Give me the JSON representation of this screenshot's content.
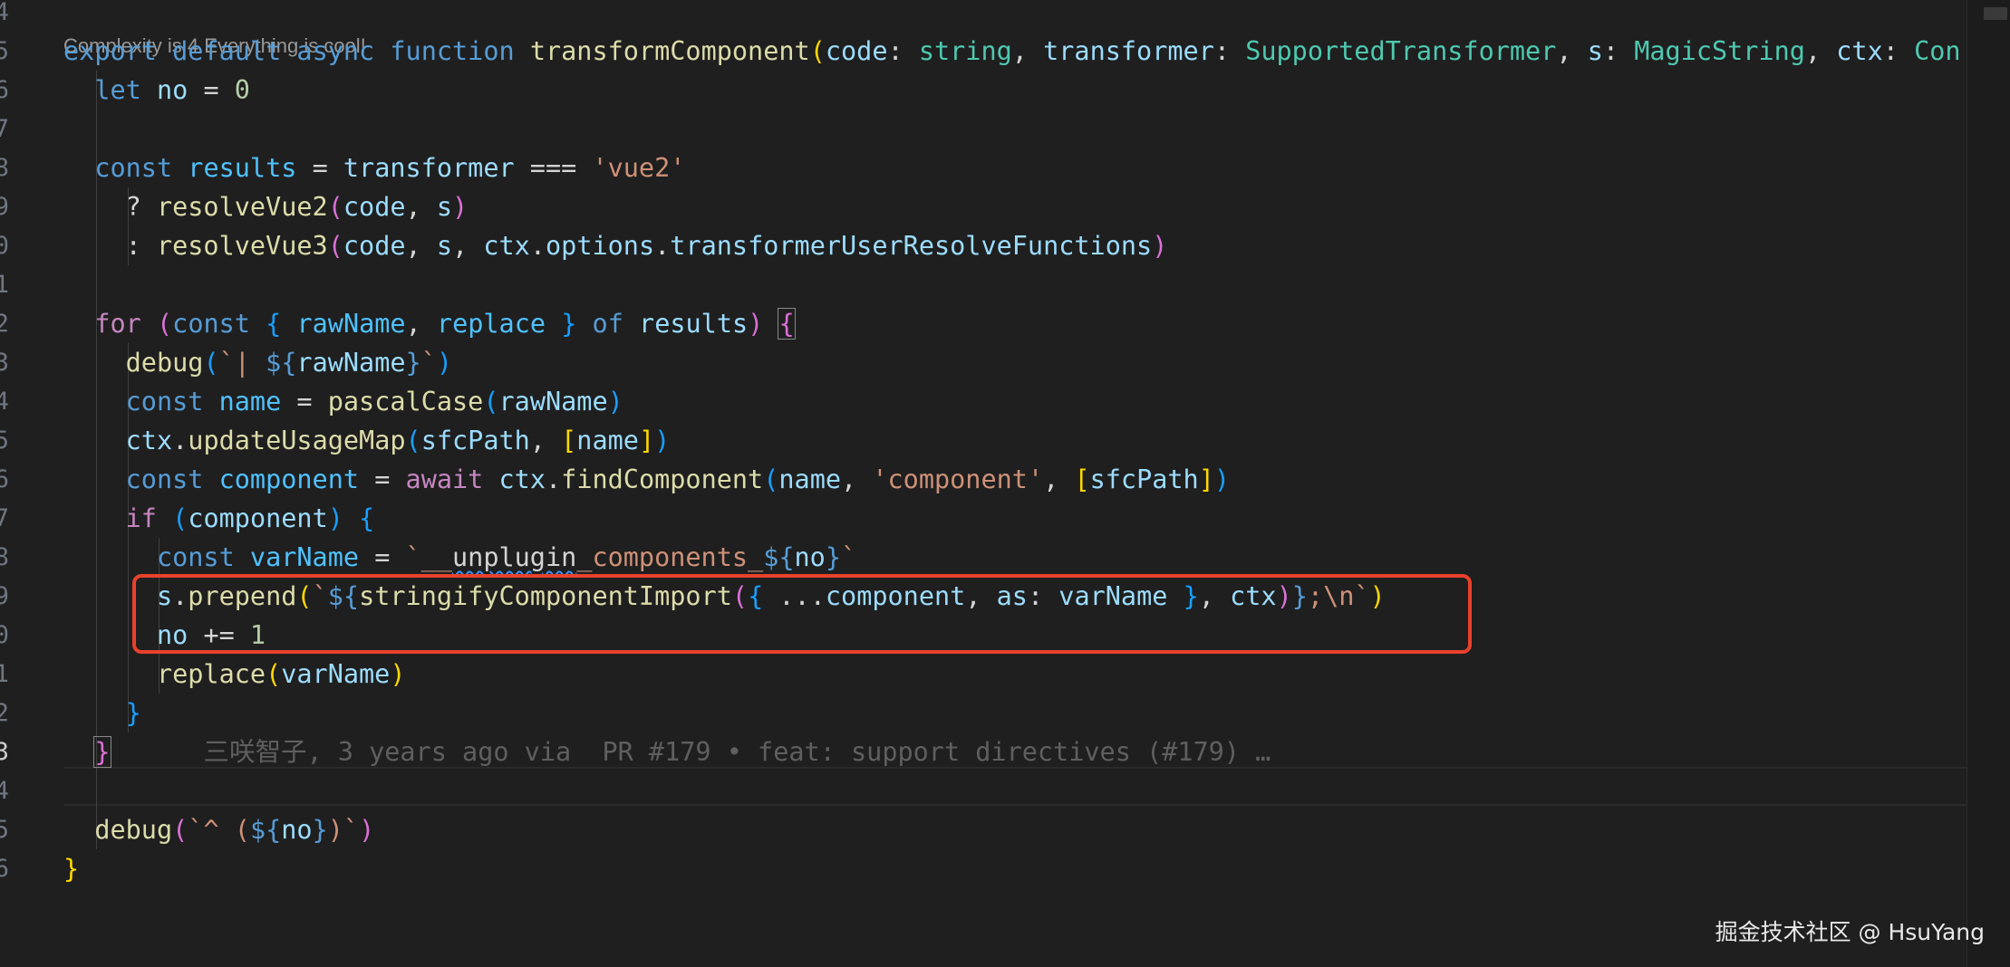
{
  "editor": {
    "codelens": "Complexity is 4 Everything is cool!",
    "blame": "三咲智子, 3 years ago via  PR #179 • feat: support directives (#179) …",
    "gutter": [
      "4",
      "5",
      "6",
      "7",
      "8",
      "9",
      "0",
      "1",
      "2",
      "3",
      "4",
      "5",
      "6",
      "7",
      "8",
      "9",
      "0",
      "1",
      "2",
      "3",
      "4",
      "5",
      "6"
    ],
    "lines": [
      [
        [
          "",
          ""
        ]
      ],
      [
        [
          "kw",
          "export"
        ],
        [
          "op",
          " "
        ],
        [
          "kw",
          "default"
        ],
        [
          "op",
          " "
        ],
        [
          "kw",
          "async"
        ],
        [
          "op",
          " "
        ],
        [
          "kw",
          "function"
        ],
        [
          "op",
          " "
        ],
        [
          "fn",
          "transformComponent"
        ],
        [
          "b1",
          "("
        ],
        [
          "var",
          "code"
        ],
        [
          "op",
          ": "
        ],
        [
          "ty",
          "string"
        ],
        [
          "op",
          ", "
        ],
        [
          "var",
          "transformer"
        ],
        [
          "op",
          ": "
        ],
        [
          "ty",
          "SupportedTransformer"
        ],
        [
          "op",
          ", "
        ],
        [
          "var",
          "s"
        ],
        [
          "op",
          ": "
        ],
        [
          "ty",
          "MagicString"
        ],
        [
          "op",
          ", "
        ],
        [
          "var",
          "ctx"
        ],
        [
          "op",
          ": "
        ],
        [
          "ty",
          "Con"
        ]
      ],
      [
        [
          "op",
          "  "
        ],
        [
          "kw",
          "let"
        ],
        [
          "op",
          " "
        ],
        [
          "var",
          "no"
        ],
        [
          "op",
          " = "
        ],
        [
          "num",
          "0"
        ]
      ],
      [
        [
          "op",
          ""
        ]
      ],
      [
        [
          "op",
          "  "
        ],
        [
          "kw",
          "const"
        ],
        [
          "op",
          " "
        ],
        [
          "cst",
          "results"
        ],
        [
          "op",
          " = "
        ],
        [
          "var",
          "transformer"
        ],
        [
          "op",
          " === "
        ],
        [
          "str",
          "'vue2'"
        ]
      ],
      [
        [
          "op",
          "    ? "
        ],
        [
          "fn",
          "resolveVue2"
        ],
        [
          "b2",
          "("
        ],
        [
          "var",
          "code"
        ],
        [
          "op",
          ", "
        ],
        [
          "var",
          "s"
        ],
        [
          "b2",
          ")"
        ]
      ],
      [
        [
          "op",
          "    : "
        ],
        [
          "fn",
          "resolveVue3"
        ],
        [
          "b2",
          "("
        ],
        [
          "var",
          "code"
        ],
        [
          "op",
          ", "
        ],
        [
          "var",
          "s"
        ],
        [
          "op",
          ", "
        ],
        [
          "var",
          "ctx"
        ],
        [
          "op",
          "."
        ],
        [
          "var",
          "options"
        ],
        [
          "op",
          "."
        ],
        [
          "var",
          "transformerUserResolveFunctions"
        ],
        [
          "b2",
          ")"
        ]
      ],
      [
        [
          "op",
          ""
        ]
      ],
      [
        [
          "op",
          "  "
        ],
        [
          "ctl",
          "for"
        ],
        [
          "op",
          " "
        ],
        [
          "b2",
          "("
        ],
        [
          "kw",
          "const"
        ],
        [
          "op",
          " "
        ],
        [
          "b3",
          "{"
        ],
        [
          "op",
          " "
        ],
        [
          "cst",
          "rawName"
        ],
        [
          "op",
          ", "
        ],
        [
          "cst",
          "replace"
        ],
        [
          "op",
          " "
        ],
        [
          "b3",
          "}"
        ],
        [
          "op",
          " "
        ],
        [
          "kw",
          "of"
        ],
        [
          "op",
          " "
        ],
        [
          "var",
          "results"
        ],
        [
          "b2",
          ")"
        ],
        [
          "op",
          " "
        ],
        [
          "b2",
          "{"
        ]
      ],
      [
        [
          "op",
          "    "
        ],
        [
          "fn",
          "debug"
        ],
        [
          "b3",
          "("
        ],
        [
          "str",
          "`| "
        ],
        [
          "kw",
          "${"
        ],
        [
          "var",
          "rawName"
        ],
        [
          "kw",
          "}"
        ],
        [
          "str",
          "`"
        ],
        [
          "b3",
          ")"
        ]
      ],
      [
        [
          "op",
          "    "
        ],
        [
          "kw",
          "const"
        ],
        [
          "op",
          " "
        ],
        [
          "cst",
          "name"
        ],
        [
          "op",
          " = "
        ],
        [
          "fn",
          "pascalCase"
        ],
        [
          "b3",
          "("
        ],
        [
          "var",
          "rawName"
        ],
        [
          "b3",
          ")"
        ]
      ],
      [
        [
          "op",
          "    "
        ],
        [
          "var",
          "ctx"
        ],
        [
          "op",
          "."
        ],
        [
          "fn",
          "updateUsageMap"
        ],
        [
          "b3",
          "("
        ],
        [
          "var",
          "sfcPath"
        ],
        [
          "op",
          ", "
        ],
        [
          "b1",
          "["
        ],
        [
          "var",
          "name"
        ],
        [
          "b1",
          "]"
        ],
        [
          "b3",
          ")"
        ]
      ],
      [
        [
          "op",
          "    "
        ],
        [
          "kw",
          "const"
        ],
        [
          "op",
          " "
        ],
        [
          "cst",
          "component"
        ],
        [
          "op",
          " = "
        ],
        [
          "ctl",
          "await"
        ],
        [
          "op",
          " "
        ],
        [
          "var",
          "ctx"
        ],
        [
          "op",
          "."
        ],
        [
          "fn",
          "findComponent"
        ],
        [
          "b3",
          "("
        ],
        [
          "var",
          "name"
        ],
        [
          "op",
          ", "
        ],
        [
          "str",
          "'component'"
        ],
        [
          "op",
          ", "
        ],
        [
          "b1",
          "["
        ],
        [
          "var",
          "sfcPath"
        ],
        [
          "b1",
          "]"
        ],
        [
          "b3",
          ")"
        ]
      ],
      [
        [
          "op",
          "    "
        ],
        [
          "ctl",
          "if"
        ],
        [
          "op",
          " "
        ],
        [
          "b3",
          "("
        ],
        [
          "var",
          "component"
        ],
        [
          "b3",
          ")"
        ],
        [
          "op",
          " "
        ],
        [
          "b3",
          "{"
        ]
      ],
      [
        [
          "op",
          "      "
        ],
        [
          "kw",
          "const"
        ],
        [
          "op",
          " "
        ],
        [
          "cst",
          "varName"
        ],
        [
          "op",
          " = "
        ],
        [
          "str",
          "`__"
        ],
        [
          "sq",
          "unplugin"
        ],
        [
          "str",
          "_components_"
        ],
        [
          "kw",
          "${"
        ],
        [
          "var",
          "no"
        ],
        [
          "kw",
          "}"
        ],
        [
          "str",
          "`"
        ]
      ],
      [
        [
          "op",
          "      "
        ],
        [
          "var",
          "s"
        ],
        [
          "op",
          "."
        ],
        [
          "fn",
          "prepend"
        ],
        [
          "b1",
          "("
        ],
        [
          "str",
          "`"
        ],
        [
          "kw",
          "${"
        ],
        [
          "fn",
          "stringifyComponentImport"
        ],
        [
          "b2",
          "("
        ],
        [
          "b3",
          "{"
        ],
        [
          "op",
          " ..."
        ],
        [
          "var",
          "component"
        ],
        [
          "op",
          ", "
        ],
        [
          "var",
          "as"
        ],
        [
          "op",
          ": "
        ],
        [
          "var",
          "varName"
        ],
        [
          "op",
          " "
        ],
        [
          "b3",
          "}"
        ],
        [
          "op",
          ", "
        ],
        [
          "var",
          "ctx"
        ],
        [
          "b2",
          ")"
        ],
        [
          "kw",
          "}"
        ],
        [
          "str",
          ";\\n`"
        ],
        [
          "b1",
          ")"
        ]
      ],
      [
        [
          "op",
          "      "
        ],
        [
          "var",
          "no"
        ],
        [
          "op",
          " += "
        ],
        [
          "num",
          "1"
        ]
      ],
      [
        [
          "op",
          "      "
        ],
        [
          "fn",
          "replace"
        ],
        [
          "b1",
          "("
        ],
        [
          "var",
          "varName"
        ],
        [
          "b1",
          ")"
        ]
      ],
      [
        [
          "op",
          "    "
        ],
        [
          "b3",
          "}"
        ]
      ],
      [
        [
          "op",
          "  "
        ],
        [
          "b2",
          "}"
        ]
      ],
      [
        [
          "op",
          ""
        ]
      ],
      [
        [
          "op",
          "  "
        ],
        [
          "fn",
          "debug"
        ],
        [
          "b2",
          "("
        ],
        [
          "str",
          "`^ ("
        ],
        [
          "kw",
          "${"
        ],
        [
          "var",
          "no"
        ],
        [
          "kw",
          "}"
        ],
        [
          "str",
          ")`"
        ],
        [
          "b2",
          ")"
        ]
      ],
      [
        [
          "b1",
          "}"
        ]
      ]
    ]
  },
  "watermark": "掘金技术社区 @ HsuYang"
}
